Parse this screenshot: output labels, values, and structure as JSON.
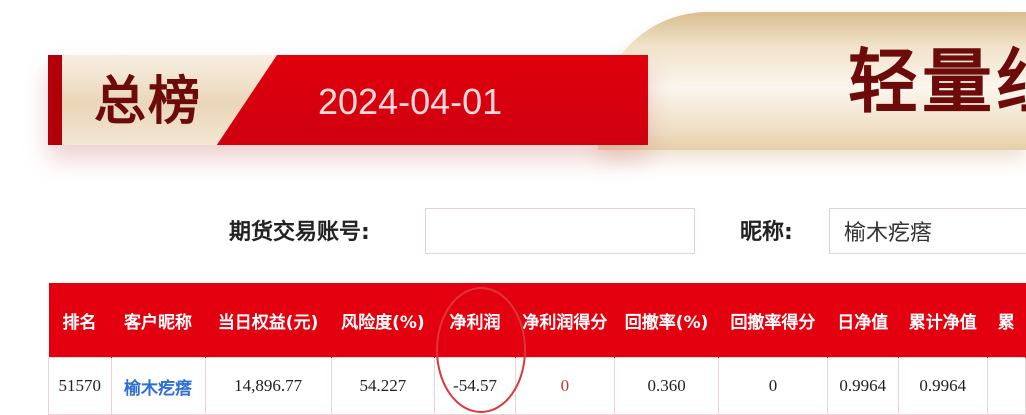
{
  "banner": {
    "title": "总榜",
    "date": "2024-04-01",
    "right_title": "轻量组"
  },
  "search": {
    "account_label": "期货交易账号:",
    "account_value": "",
    "account_placeholder": "",
    "nickname_label": "昵称:",
    "nickname_value": "榆木疙瘩"
  },
  "table": {
    "headers": [
      "排名",
      "客户昵称",
      "当日权益(元)",
      "风险度(%)",
      "净利润",
      "净利润得分",
      "回撤率(%)",
      "回撤率得分",
      "日净值",
      "累计净值",
      "累"
    ],
    "rows": [
      [
        "51570",
        "榆木疙瘩",
        "14,896.77",
        "54.227",
        "-54.57",
        "0",
        "0.360",
        "0",
        "0.9964",
        "0.9964",
        ""
      ]
    ]
  },
  "colors": {
    "header_red": "#e3000f",
    "title_dark": "#6d0a0a",
    "nickname_blue": "#2c6fd6",
    "annotation_circle": "#e0343a"
  }
}
